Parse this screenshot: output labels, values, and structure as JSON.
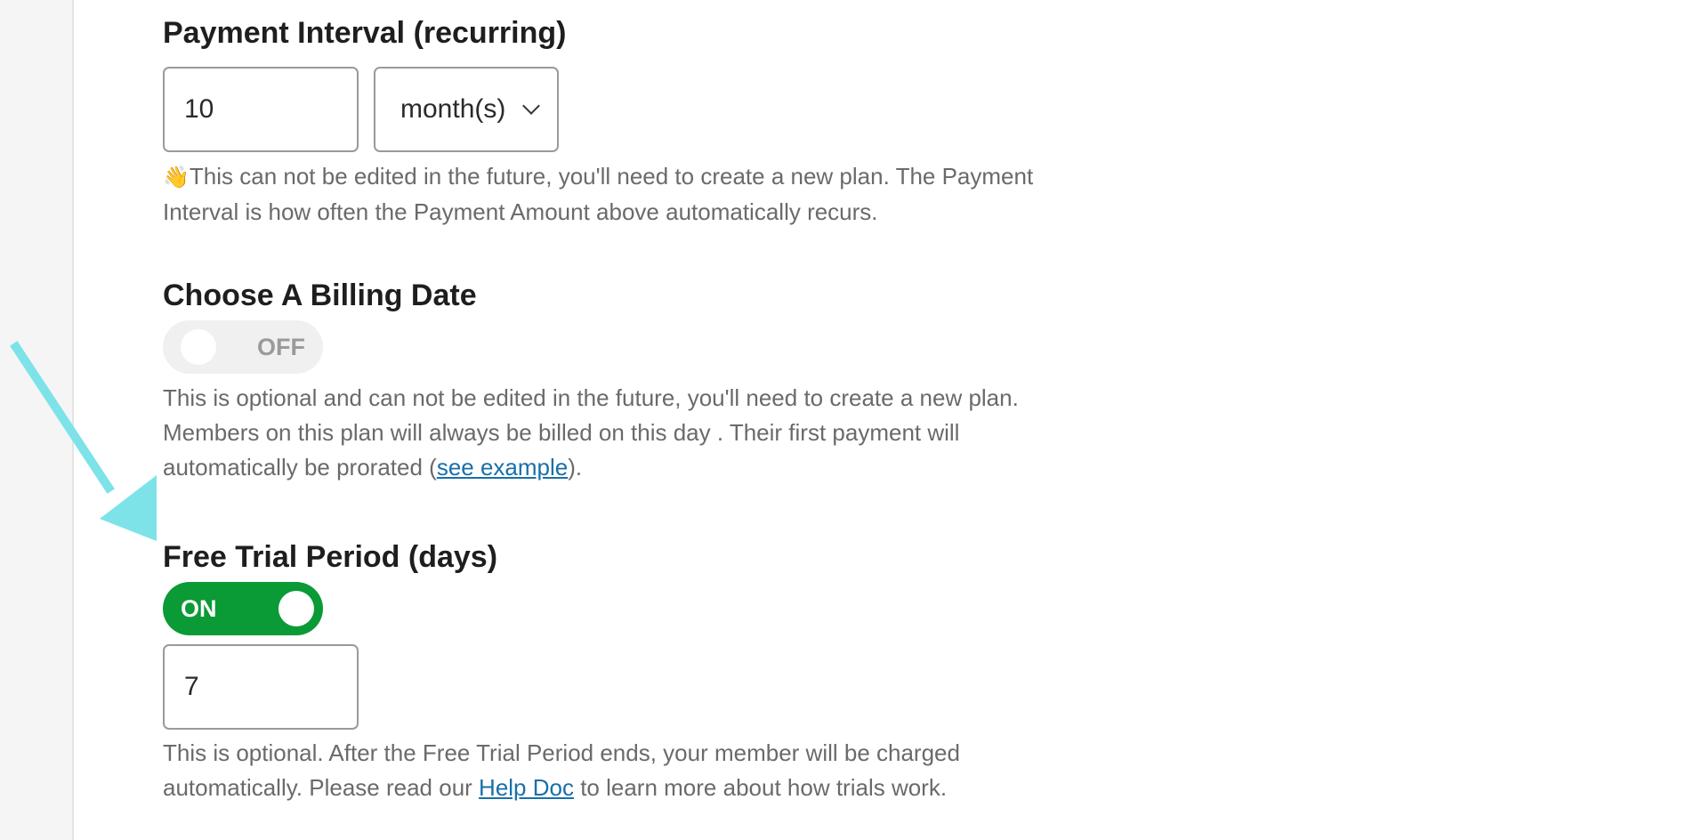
{
  "payment_interval": {
    "title": "Payment Interval (recurring)",
    "count_value": "10",
    "unit_value": "month(s)",
    "help_emoji": "👋",
    "help_text": "This can not be edited in the future, you'll need to create a new plan. The Payment Interval is how often the Payment Amount above automatically recurs."
  },
  "billing_date": {
    "title": "Choose A Billing Date",
    "toggle_label": "OFF",
    "help_text_before": "This is optional and can not be edited in the future, you'll need to create a new plan. Members on this plan will always be billed on this day . Their first payment will automatically be prorated (",
    "help_link": "see example",
    "help_text_after": ")."
  },
  "free_trial": {
    "title": "Free Trial Period (days)",
    "toggle_label": "ON",
    "days_value": "7",
    "help_text_before": "This is optional. After the Free Trial Period ends, your member will be charged automatically. Please read our ",
    "help_link": "Help Doc",
    "help_text_after": " to learn more about how trials work."
  },
  "annotation": {
    "arrow_color": "#7de3e8",
    "icon": "pointer-arrow-icon"
  },
  "colors": {
    "toggle_on": "#0a9a36",
    "toggle_off": "#f0f0f0",
    "link": "#1a6fa8"
  }
}
